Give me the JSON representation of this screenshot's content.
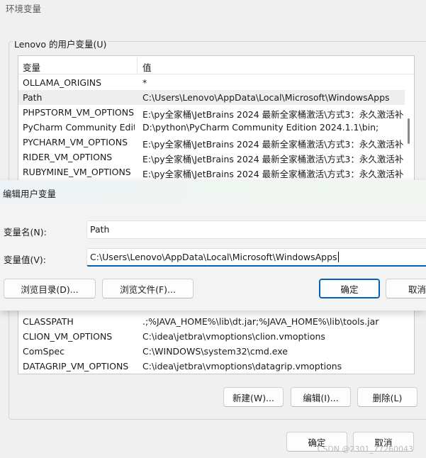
{
  "window": {
    "title": "环境变量"
  },
  "user_vars": {
    "group_label": "Lenovo 的用户变量(U)",
    "columns": {
      "name": "变量",
      "value": "值"
    },
    "rows": [
      {
        "name": "OLLAMA_ORIGINS",
        "value": "*"
      },
      {
        "name": "Path",
        "value": "C:\\Users\\Lenovo\\AppData\\Local\\Microsoft\\WindowsApps"
      },
      {
        "name": "PHPSTORM_VM_OPTIONS",
        "value": "E:\\py全家桶\\JetBrains  2024 最新全家桶激活\\方式3：永久激活补..."
      },
      {
        "name": "PyCharm Community Editi...",
        "value": "D:\\python\\PyCharm Community Edition 2024.1.1\\bin;"
      },
      {
        "name": "PYCHARM_VM_OPTIONS",
        "value": "E:\\py全家桶\\JetBrains  2024 最新全家桶激活\\方式3：永久激活补..."
      },
      {
        "name": "RIDER_VM_OPTIONS",
        "value": "E:\\py全家桶\\JetBrains  2024 最新全家桶激活\\方式3：永久激活补..."
      },
      {
        "name": "RUBYMINE_VM_OPTIONS",
        "value": "E:\\py全家桶\\JetBrains  2024 最新全家桶激活\\方式3：永久激活补..."
      }
    ]
  },
  "system_vars": {
    "rows": [
      {
        "name": "CLASSPATH",
        "value": ".;%JAVA_HOME%\\lib\\dt.jar;%JAVA_HOME%\\lib\\tools.jar"
      },
      {
        "name": "CLION_VM_OPTIONS",
        "value": "C:\\idea\\jetbra\\vmoptions\\clion.vmoptions"
      },
      {
        "name": "ComSpec",
        "value": "C:\\WINDOWS\\system32\\cmd.exe"
      },
      {
        "name": "DATAGRIP_VM_OPTIONS",
        "value": "C:\\idea\\jetbra\\vmoptions\\datagrip.vmoptions"
      }
    ],
    "new_label": "新建(W)...",
    "edit_label": "编辑(I)...",
    "delete_label": "删除(L)"
  },
  "footer": {
    "ok_label": "确定",
    "cancel_label": "取消"
  },
  "dialog": {
    "title": "编辑用户变量",
    "name_label": "变量名(N):",
    "name_value": "Path",
    "value_label": "变量值(V):",
    "value_value": "C:\\Users\\Lenovo\\AppData\\Local\\Microsoft\\WindowsApps",
    "browse_dir_label": "浏览目录(D)...",
    "browse_file_label": "浏览文件(F)...",
    "ok_label": "确定",
    "cancel_label": "取消"
  },
  "watermark": "CSDN @2301_77260043",
  "colors": {
    "accent": "#005fb8",
    "selected_row": "#eeeeee",
    "background": "#f0f0f0"
  }
}
